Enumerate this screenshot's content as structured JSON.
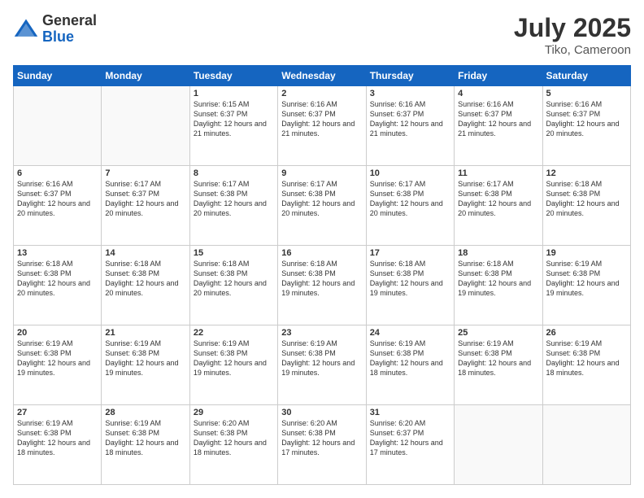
{
  "logo": {
    "general": "General",
    "blue": "Blue"
  },
  "header": {
    "month": "July 2025",
    "location": "Tiko, Cameroon"
  },
  "weekdays": [
    "Sunday",
    "Monday",
    "Tuesday",
    "Wednesday",
    "Thursday",
    "Friday",
    "Saturday"
  ],
  "weeks": [
    [
      {
        "day": "",
        "info": ""
      },
      {
        "day": "",
        "info": ""
      },
      {
        "day": "1",
        "info": "Sunrise: 6:15 AM\nSunset: 6:37 PM\nDaylight: 12 hours and 21 minutes."
      },
      {
        "day": "2",
        "info": "Sunrise: 6:16 AM\nSunset: 6:37 PM\nDaylight: 12 hours and 21 minutes."
      },
      {
        "day": "3",
        "info": "Sunrise: 6:16 AM\nSunset: 6:37 PM\nDaylight: 12 hours and 21 minutes."
      },
      {
        "day": "4",
        "info": "Sunrise: 6:16 AM\nSunset: 6:37 PM\nDaylight: 12 hours and 21 minutes."
      },
      {
        "day": "5",
        "info": "Sunrise: 6:16 AM\nSunset: 6:37 PM\nDaylight: 12 hours and 20 minutes."
      }
    ],
    [
      {
        "day": "6",
        "info": "Sunrise: 6:16 AM\nSunset: 6:37 PM\nDaylight: 12 hours and 20 minutes."
      },
      {
        "day": "7",
        "info": "Sunrise: 6:17 AM\nSunset: 6:37 PM\nDaylight: 12 hours and 20 minutes."
      },
      {
        "day": "8",
        "info": "Sunrise: 6:17 AM\nSunset: 6:38 PM\nDaylight: 12 hours and 20 minutes."
      },
      {
        "day": "9",
        "info": "Sunrise: 6:17 AM\nSunset: 6:38 PM\nDaylight: 12 hours and 20 minutes."
      },
      {
        "day": "10",
        "info": "Sunrise: 6:17 AM\nSunset: 6:38 PM\nDaylight: 12 hours and 20 minutes."
      },
      {
        "day": "11",
        "info": "Sunrise: 6:17 AM\nSunset: 6:38 PM\nDaylight: 12 hours and 20 minutes."
      },
      {
        "day": "12",
        "info": "Sunrise: 6:18 AM\nSunset: 6:38 PM\nDaylight: 12 hours and 20 minutes."
      }
    ],
    [
      {
        "day": "13",
        "info": "Sunrise: 6:18 AM\nSunset: 6:38 PM\nDaylight: 12 hours and 20 minutes."
      },
      {
        "day": "14",
        "info": "Sunrise: 6:18 AM\nSunset: 6:38 PM\nDaylight: 12 hours and 20 minutes."
      },
      {
        "day": "15",
        "info": "Sunrise: 6:18 AM\nSunset: 6:38 PM\nDaylight: 12 hours and 20 minutes."
      },
      {
        "day": "16",
        "info": "Sunrise: 6:18 AM\nSunset: 6:38 PM\nDaylight: 12 hours and 19 minutes."
      },
      {
        "day": "17",
        "info": "Sunrise: 6:18 AM\nSunset: 6:38 PM\nDaylight: 12 hours and 19 minutes."
      },
      {
        "day": "18",
        "info": "Sunrise: 6:18 AM\nSunset: 6:38 PM\nDaylight: 12 hours and 19 minutes."
      },
      {
        "day": "19",
        "info": "Sunrise: 6:19 AM\nSunset: 6:38 PM\nDaylight: 12 hours and 19 minutes."
      }
    ],
    [
      {
        "day": "20",
        "info": "Sunrise: 6:19 AM\nSunset: 6:38 PM\nDaylight: 12 hours and 19 minutes."
      },
      {
        "day": "21",
        "info": "Sunrise: 6:19 AM\nSunset: 6:38 PM\nDaylight: 12 hours and 19 minutes."
      },
      {
        "day": "22",
        "info": "Sunrise: 6:19 AM\nSunset: 6:38 PM\nDaylight: 12 hours and 19 minutes."
      },
      {
        "day": "23",
        "info": "Sunrise: 6:19 AM\nSunset: 6:38 PM\nDaylight: 12 hours and 19 minutes."
      },
      {
        "day": "24",
        "info": "Sunrise: 6:19 AM\nSunset: 6:38 PM\nDaylight: 12 hours and 18 minutes."
      },
      {
        "day": "25",
        "info": "Sunrise: 6:19 AM\nSunset: 6:38 PM\nDaylight: 12 hours and 18 minutes."
      },
      {
        "day": "26",
        "info": "Sunrise: 6:19 AM\nSunset: 6:38 PM\nDaylight: 12 hours and 18 minutes."
      }
    ],
    [
      {
        "day": "27",
        "info": "Sunrise: 6:19 AM\nSunset: 6:38 PM\nDaylight: 12 hours and 18 minutes."
      },
      {
        "day": "28",
        "info": "Sunrise: 6:19 AM\nSunset: 6:38 PM\nDaylight: 12 hours and 18 minutes."
      },
      {
        "day": "29",
        "info": "Sunrise: 6:20 AM\nSunset: 6:38 PM\nDaylight: 12 hours and 18 minutes."
      },
      {
        "day": "30",
        "info": "Sunrise: 6:20 AM\nSunset: 6:38 PM\nDaylight: 12 hours and 17 minutes."
      },
      {
        "day": "31",
        "info": "Sunrise: 6:20 AM\nSunset: 6:37 PM\nDaylight: 12 hours and 17 minutes."
      },
      {
        "day": "",
        "info": ""
      },
      {
        "day": "",
        "info": ""
      }
    ]
  ]
}
